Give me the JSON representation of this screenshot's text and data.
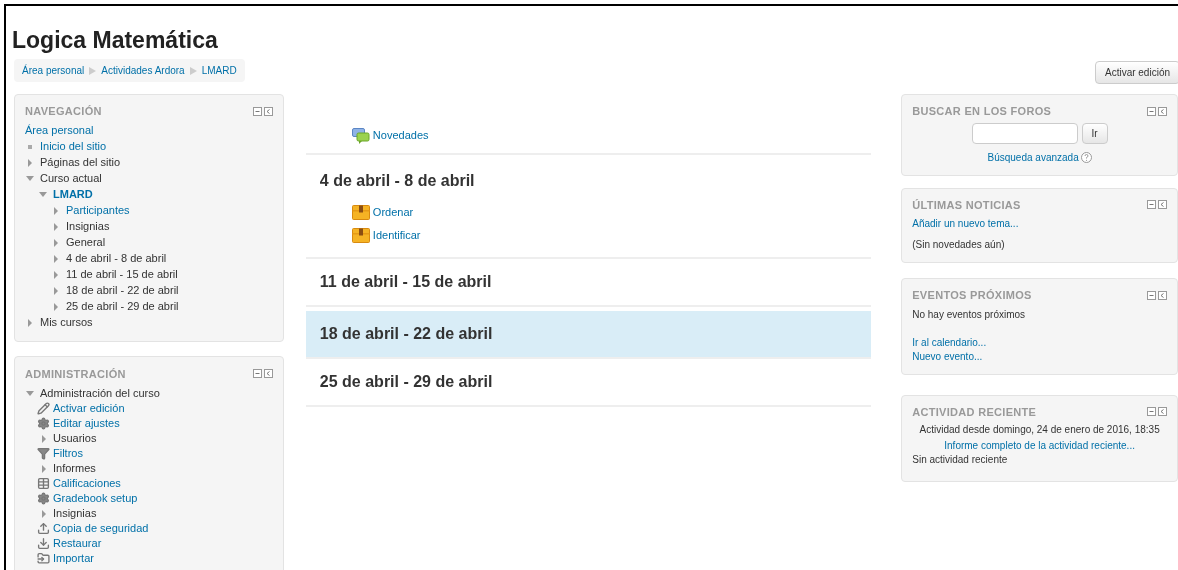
{
  "page": {
    "title": "Logica Matemática",
    "breadcrumb": [
      "Área personal",
      "Actividades Ardora",
      "LMARD"
    ],
    "edit_button": "Activar edición"
  },
  "navigation": {
    "title": "NAVEGACIÓN",
    "items": [
      {
        "label": "Área personal",
        "link": true,
        "current": false
      },
      {
        "label": "Inicio del sitio",
        "kind": "bullet",
        "link": true,
        "current": false
      },
      {
        "label": "Páginas del sitio",
        "kind": "branch",
        "expanded": false,
        "link": false,
        "current": false
      },
      {
        "label": "Curso actual",
        "kind": "branch",
        "expanded": true,
        "link": false,
        "current": false,
        "children": [
          {
            "label": "LMARD",
            "kind": "branch",
            "expanded": true,
            "link": true,
            "current": true,
            "children": [
              {
                "label": "Participantes",
                "kind": "branch",
                "expanded": false,
                "link": true,
                "current": false
              },
              {
                "label": "Insignias",
                "kind": "branch",
                "expanded": false,
                "link": false,
                "current": false
              },
              {
                "label": "General",
                "kind": "branch",
                "expanded": false,
                "link": false,
                "current": false
              },
              {
                "label": "4 de abril - 8 de abril",
                "kind": "branch",
                "expanded": false,
                "link": false,
                "current": false
              },
              {
                "label": "11 de abril - 15 de abril",
                "kind": "branch",
                "expanded": false,
                "link": false,
                "current": false
              },
              {
                "label": "18 de abril - 22 de abril",
                "kind": "branch",
                "expanded": false,
                "link": false,
                "current": false
              },
              {
                "label": "25 de abril - 29 de abril",
                "kind": "branch",
                "expanded": false,
                "link": false,
                "current": false
              }
            ]
          }
        ]
      },
      {
        "label": "Mis cursos",
        "kind": "branch",
        "expanded": false,
        "link": false,
        "current": false
      }
    ]
  },
  "administration": {
    "title": "ADMINISTRACIÓN",
    "section": "Administración del curso",
    "expanded": true,
    "items": [
      {
        "label": "Activar edición",
        "kind": "pencil",
        "link": true
      },
      {
        "label": "Editar ajustes",
        "kind": "gear",
        "link": true
      },
      {
        "label": "Usuarios",
        "kind": "branch",
        "link": false
      },
      {
        "label": "Filtros",
        "kind": "filter",
        "link": true
      },
      {
        "label": "Informes",
        "kind": "branch",
        "link": false
      },
      {
        "label": "Calificaciones",
        "kind": "table",
        "link": true
      },
      {
        "label": "Gradebook setup",
        "kind": "gear",
        "link": true
      },
      {
        "label": "Insignias",
        "kind": "branch",
        "link": false
      },
      {
        "label": "Copia de seguridad",
        "kind": "upload",
        "link": true
      },
      {
        "label": "Restaurar",
        "kind": "download",
        "link": true
      },
      {
        "label": "Importar",
        "kind": "import",
        "link": true
      }
    ]
  },
  "course": {
    "intro": [
      {
        "label": "Novedades",
        "kind": "forum"
      }
    ],
    "sections": [
      {
        "title": "4 de abril - 8 de abril",
        "selected": false,
        "activities": [
          {
            "label": "Ordenar",
            "kind": "package"
          },
          {
            "label": "Identificar",
            "kind": "package"
          }
        ]
      },
      {
        "title": "11 de abril - 15 de abril",
        "selected": false
      },
      {
        "title": "18 de abril - 22 de abril",
        "selected": true
      },
      {
        "title": "25 de abril - 29 de abril",
        "selected": false
      }
    ]
  },
  "forum_search": {
    "title": "BUSCAR EN LOS FOROS",
    "go": "Ir",
    "advanced": "Búsqueda avanzada"
  },
  "news": {
    "title": "ÚLTIMAS NOTICIAS",
    "add": "Añadir un nuevo tema...",
    "empty": "(Sin novedades aún)"
  },
  "events": {
    "title": "EVENTOS PRÓXIMOS",
    "empty": "No hay eventos próximos",
    "links": [
      "Ir al calendario...",
      "Nuevo evento..."
    ]
  },
  "recent": {
    "title": "ACTIVIDAD RECIENTE",
    "since": "Actividad desde domingo, 24 de enero de 2016, 18:35",
    "report": "Informe completo de la actividad reciente...",
    "empty": "Sin actividad reciente"
  }
}
